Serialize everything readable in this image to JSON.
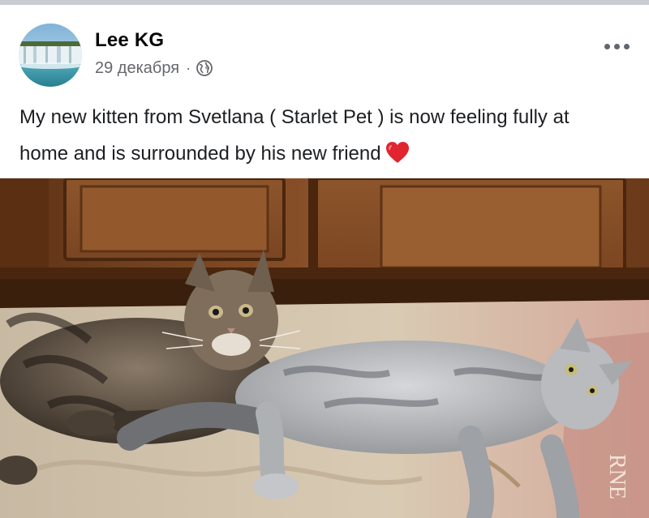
{
  "post": {
    "author": "Lee KG",
    "date": "29 декабря",
    "separator": "·",
    "privacy_icon": "globe-icon",
    "menu_icon": "more-options-icon",
    "message": "My new kitten from Svetlana ( Starlet Pet ) is now feeling fully at home and is surrounded by his new friend",
    "message_emoji": "heart-icon",
    "rug_text": "RNE"
  },
  "colors": {
    "author_text": "#050505",
    "meta_text": "#65676b",
    "heart": "#e0252f",
    "cabinet": "#7a4521"
  }
}
